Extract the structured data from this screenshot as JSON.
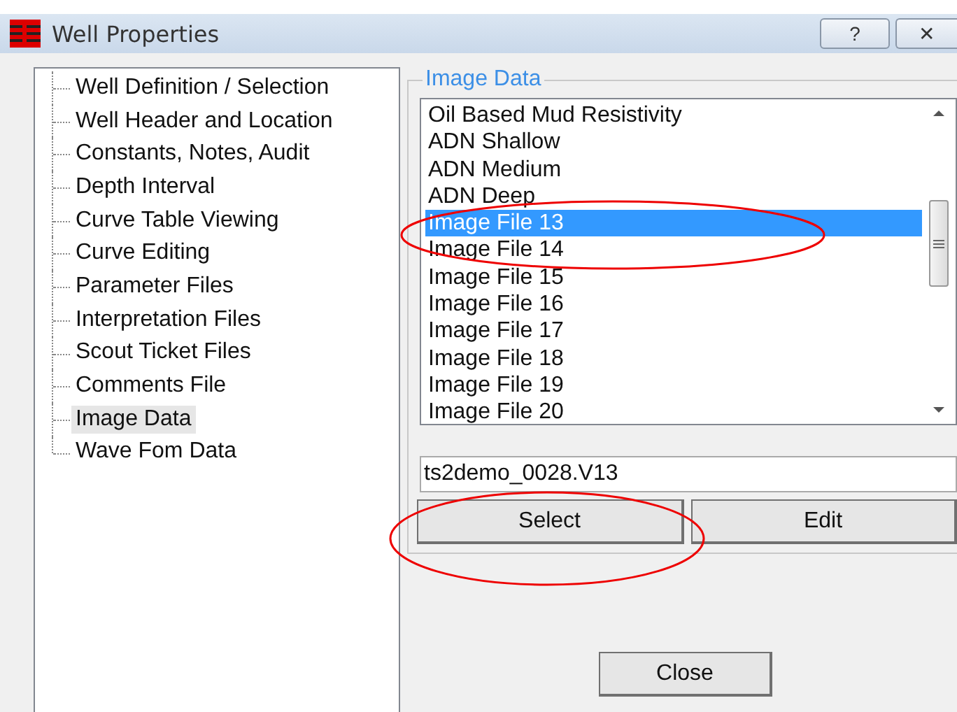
{
  "window": {
    "title": "Well Properties",
    "buttons": [
      "?",
      "✕"
    ]
  },
  "tree": {
    "items": [
      {
        "label": "Well Definition / Selection",
        "selected": false
      },
      {
        "label": "Well Header and Location",
        "selected": false
      },
      {
        "label": "Constants, Notes, Audit",
        "selected": false
      },
      {
        "label": "Depth Interval",
        "selected": false
      },
      {
        "label": "Curve Table Viewing",
        "selected": false
      },
      {
        "label": "Curve Editing",
        "selected": false
      },
      {
        "label": "Parameter Files",
        "selected": false
      },
      {
        "label": "Interpretation Files",
        "selected": false
      },
      {
        "label": "Scout Ticket Files",
        "selected": false
      },
      {
        "label": "Comments File",
        "selected": false
      },
      {
        "label": "Image Data",
        "selected": true
      },
      {
        "label": "Wave Fom Data",
        "selected": false
      }
    ]
  },
  "image_data": {
    "title": "Image Data",
    "list": [
      {
        "label": "Oil Based Mud Resistivity",
        "selected": false
      },
      {
        "label": "ADN Shallow",
        "selected": false
      },
      {
        "label": "ADN Medium",
        "selected": false
      },
      {
        "label": "ADN Deep",
        "selected": false
      },
      {
        "label": "Image File 13",
        "selected": true
      },
      {
        "label": "Image File 14",
        "selected": false
      },
      {
        "label": "Image File 15",
        "selected": false
      },
      {
        "label": "Image File 16",
        "selected": false
      },
      {
        "label": "Image File 17",
        "selected": false
      },
      {
        "label": "Image File 18",
        "selected": false
      },
      {
        "label": "Image File 19",
        "selected": false
      },
      {
        "label": "Image File 20",
        "selected": false
      }
    ],
    "file": "ts2demo_0028.V13",
    "buttons": [
      "Select",
      "Edit"
    ]
  },
  "close_button": "Close"
}
